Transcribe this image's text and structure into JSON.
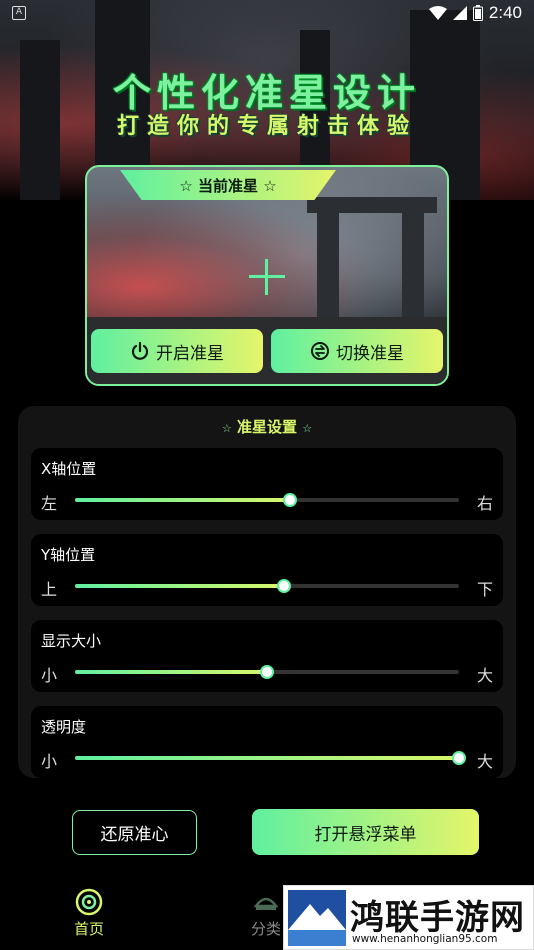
{
  "status_bar": {
    "left_icon": "A",
    "time": "2:40",
    "icons": [
      "wifi-icon",
      "signal-icon",
      "battery-icon"
    ]
  },
  "header": {
    "title": "个性化准星设计",
    "subtitle": "打造你的专属射击体验"
  },
  "preview": {
    "tag": "☆ 当前准星 ☆",
    "enable_button": "开启准星",
    "switch_button": "切换准星"
  },
  "settings": {
    "title": "准星设置",
    "rows": [
      {
        "label": "X轴位置",
        "min": "左",
        "max": "右",
        "value": 0.56
      },
      {
        "label": "Y轴位置",
        "min": "上",
        "max": "下",
        "value": 0.545
      },
      {
        "label": "显示大小",
        "min": "小",
        "max": "大",
        "value": 0.5
      },
      {
        "label": "透明度",
        "min": "小",
        "max": "大",
        "value": 1.0
      }
    ]
  },
  "actions": {
    "reset": "还原准心",
    "float_menu": "打开悬浮菜单"
  },
  "nav": {
    "home": "首页",
    "category": "分类"
  },
  "watermark": {
    "title": "鸿联手游网",
    "url": "www.henanhonglian95.com"
  },
  "colors": {
    "accent_green": "#5ff0a0",
    "accent_yellow": "#e5f56a",
    "panel_bg": "#141414"
  }
}
